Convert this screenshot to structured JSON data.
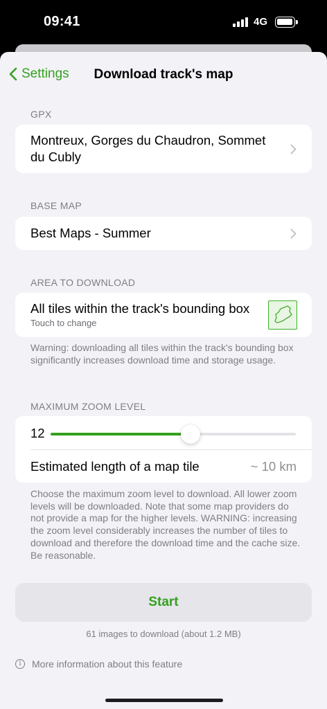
{
  "status_bar": {
    "time": "09:41",
    "network": "4G"
  },
  "nav": {
    "back_label": "Settings",
    "title": "Download track's map"
  },
  "gpx": {
    "label": "GPX",
    "value_line1": "Montreux, Gorges du Chaudron, Sommet",
    "value_line2": "du Cubly"
  },
  "base_map": {
    "label": "BASE MAP",
    "value": "Best Maps - Summer"
  },
  "area": {
    "label": "AREA TO DOWNLOAD",
    "title": "All tiles within the track's bounding box",
    "subtitle": "Touch to change",
    "warning": "Warning: downloading all tiles within the track's bounding box significantly increases download time and storage usage."
  },
  "zoom": {
    "label": "MAXIMUM ZOOM LEVEL",
    "value": "12",
    "slider_fraction": 0.57,
    "tile_label": "Estimated length of a map tile",
    "tile_value": "~ 10 km",
    "note": "Choose the maximum zoom level to download. All lower zoom levels will be downloaded. Note that some map providers do not provide a map for the higher levels. WARNING: increasing the zoom level considerably increases the number of tiles to download and therefore the download time and the cache size. Be reasonable."
  },
  "start_label": "Start",
  "download_info": "61 images to download (about 1.2 MB)",
  "more_info": "More information about this feature",
  "colors": {
    "accent": "#34a11e",
    "background": "#f2f2f7",
    "secondary_text": "#7e7e83"
  }
}
